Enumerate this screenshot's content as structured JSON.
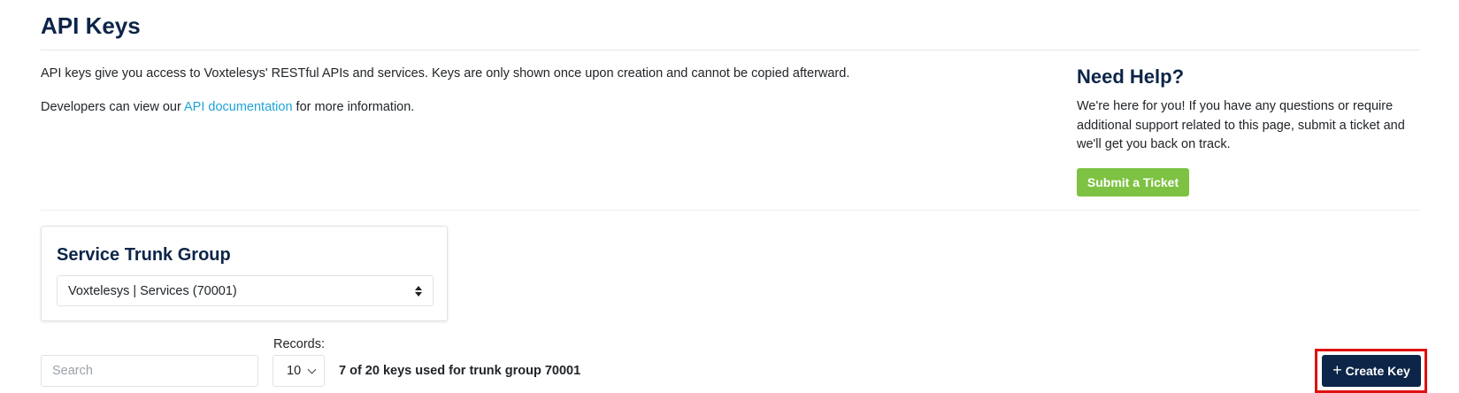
{
  "page": {
    "title": "API Keys"
  },
  "intro": {
    "line1": "API keys give you access to Voxtelesys' RESTful APIs and services. Keys are only shown once upon creation and cannot be copied afterward.",
    "line2_prefix": "Developers can view our ",
    "line2_link": "API documentation",
    "line2_suffix": " for more information."
  },
  "help": {
    "title": "Need Help?",
    "text": "We're here for you! If you have any questions or require additional support related to this page, submit a ticket and we'll get you back on track.",
    "button_label": "Submit a Ticket",
    "button_color": "#7dc242"
  },
  "trunk_group": {
    "title": "Service Trunk Group",
    "selected": "Voxtelesys | Services (70001)"
  },
  "toolbar": {
    "search_placeholder": "Search",
    "records_label": "Records:",
    "records_value": "10",
    "usage_text": "7 of 20 keys used for trunk group 70001",
    "create_label": "Create Key",
    "create_icon": "plus-icon",
    "create_color": "#0c2548",
    "highlight_color": "#e01010"
  },
  "colors": {
    "heading": "#0c2548",
    "link": "#1fa3d8"
  }
}
